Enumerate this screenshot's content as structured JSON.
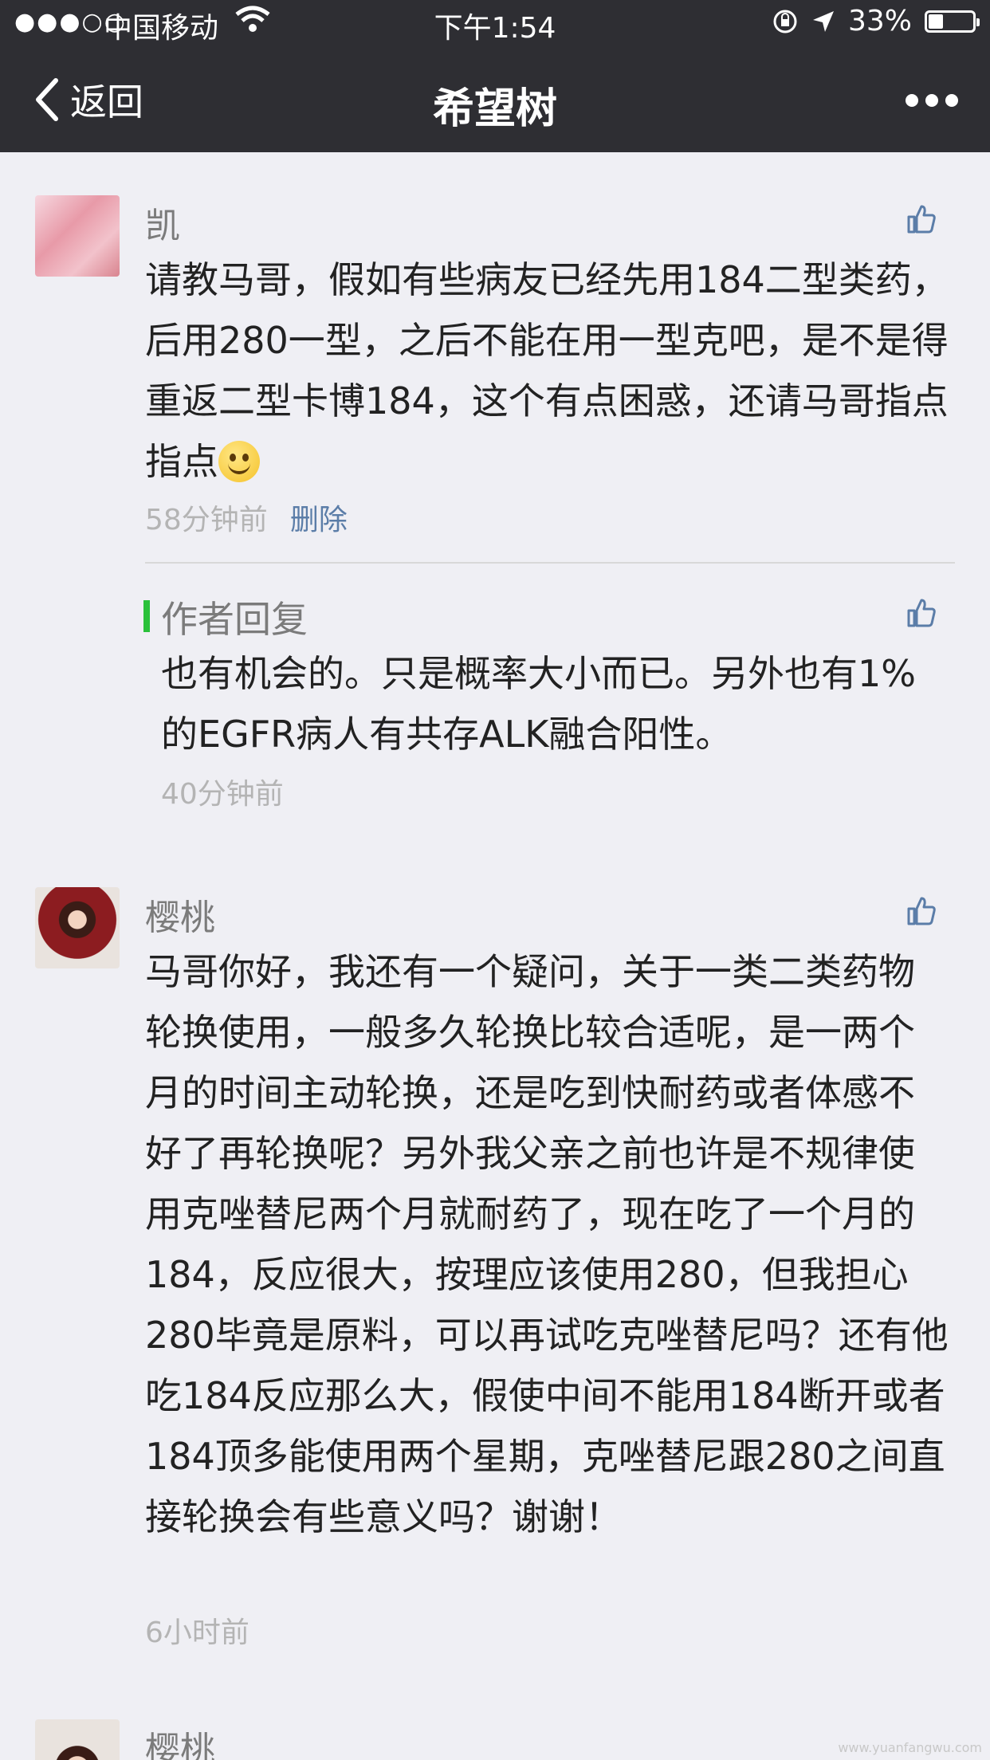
{
  "status_bar": {
    "signal": "●●●○○",
    "carrier": "中国移动",
    "time": "下午1:54",
    "battery": "33%"
  },
  "nav": {
    "back_label": "返回",
    "title": "希望树"
  },
  "comments": [
    {
      "author": "凯",
      "text": "请教马哥，假如有些病友已经先用184二型类药，后用280一型，之后不能在用一型克吧，是不是得重返二型卡博184，这个有点困惑，还请马哥指点指点",
      "time": "58分钟前",
      "delete_label": "删除",
      "reply": {
        "title": "作者回复",
        "text": "也有机会的。只是概率大小而已。另外也有1%的EGFR病人有共存ALK融合阳性。",
        "time": "40分钟前"
      }
    },
    {
      "author": "樱桃",
      "text": "马哥你好，我还有一个疑问，关于一类二类药物轮换使用，一般多久轮换比较合适呢，是一两个月的时间主动轮换，还是吃到快耐药或者体感不好了再轮换呢？另外我父亲之前也许是不规律使用克唑替尼两个月就耐药了，现在吃了一个月的184，反应很大，按理应该使用280，但我担心280毕竟是原料，可以再试吃克唑替尼吗？还有他吃184反应那么大，假使中间不能用184断开或者184顶多能使用两个星期，克唑替尼跟280之间直接轮换会有些意义吗？谢谢！",
      "time": "6小时前"
    },
    {
      "author": "樱桃"
    }
  ],
  "watermark": "www.yuanfangwu.com"
}
